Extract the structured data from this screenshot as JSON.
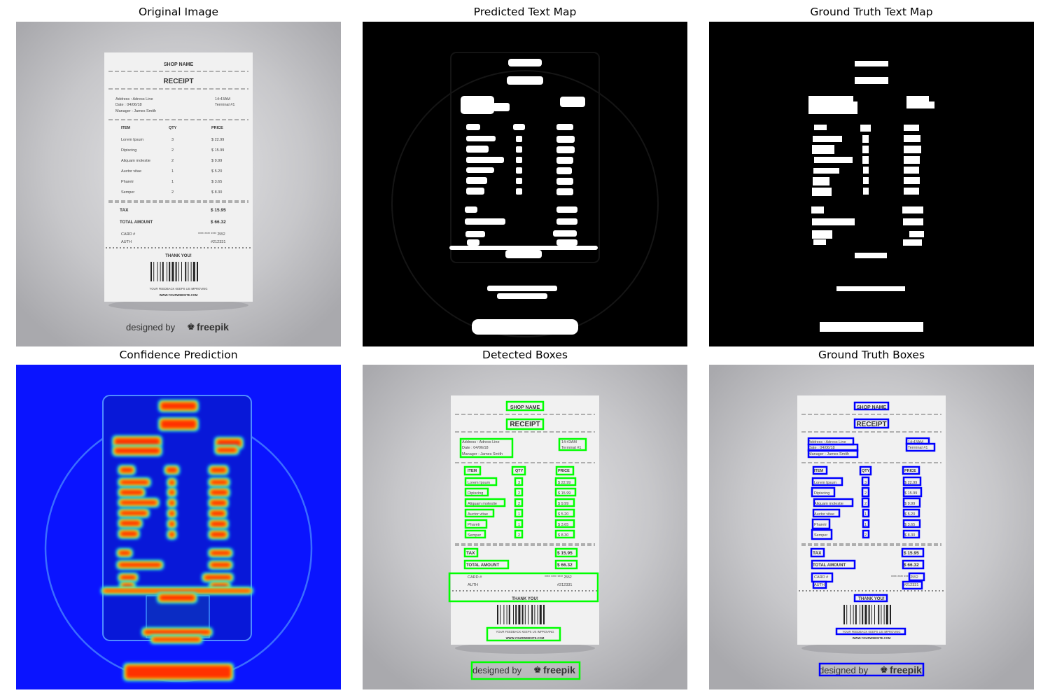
{
  "panels": {
    "p1": {
      "title": "Original Image"
    },
    "p2": {
      "title": "Predicted Text Map"
    },
    "p3": {
      "title": "Ground Truth Text Map"
    },
    "p4": {
      "title": "Confidence Prediction"
    },
    "p5": {
      "title": "Detected Boxes"
    },
    "p6": {
      "title": "Ground Truth Boxes"
    }
  },
  "receipt": {
    "shop_name": "SHOP NAME",
    "title": "RECEIPT",
    "address": "Address : Adress Line",
    "date": "Date : 04/06/18",
    "manager": "Manager : James Smith",
    "time": "14:43AM",
    "terminal": "Terminal #1",
    "col_item": "ITEM",
    "col_qty": "QTY",
    "col_price": "PRICE",
    "items": [
      {
        "name": "Lorem Ipsum",
        "qty": "3",
        "price": "$ 22.99"
      },
      {
        "name": "Dipiscing",
        "qty": "2",
        "price": "$ 15.99"
      },
      {
        "name": "Aliquam molestie",
        "qty": "2",
        "price": "$ 9.99"
      },
      {
        "name": "Auctor vitae",
        "qty": "1",
        "price": "$ 5.20"
      },
      {
        "name": "Pharetr",
        "qty": "1",
        "price": "$ 3.65"
      },
      {
        "name": "Semper",
        "qty": "2",
        "price": "$ 8.30"
      }
    ],
    "tax_label": "TAX",
    "tax_value": "$ 15.95",
    "total_label": "TOTAL AMOUNT",
    "total_value": "$ 66.32",
    "card_label": "CARD #",
    "card_value": "**** **** **** 2552",
    "auth_label": "AUTH",
    "auth_value": "#212331",
    "thank_you": "THANK YOU!",
    "feedback": "YOUR FEEDBACK KEEPS US IMPROVING",
    "website": "WWW.YOURWEBSITE.COM",
    "credit_prefix": "designed by",
    "credit_brand": "freepik"
  },
  "colors": {
    "detected_box": "#00ff00",
    "ground_truth_box": "#0000ff",
    "text_map_fg": "#ffffff",
    "text_map_bg": "#000000"
  }
}
